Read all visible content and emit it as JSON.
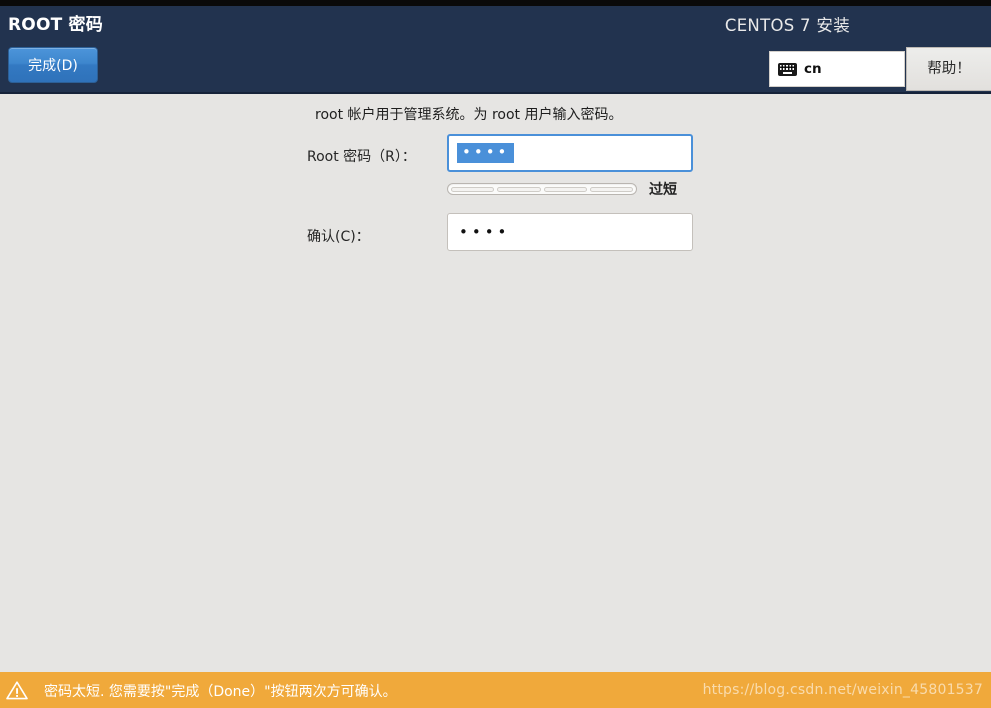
{
  "header": {
    "title": "ROOT 密码",
    "done_button": "完成(D)",
    "product_title": "CENTOS 7 安装",
    "keyboard_layout": "cn",
    "keyboard_icon": "keyboard-icon",
    "help_button": "帮助！"
  },
  "main": {
    "intro_text": "root 帐户用于管理系统。为 root 用户输入密码。",
    "password_field": {
      "label": "Root 密码（R）：",
      "value": "••••",
      "focused": true,
      "selected": true
    },
    "strength": {
      "segments_total": 4,
      "segments_filled": 0,
      "label": "过短"
    },
    "confirm_field": {
      "label": "确认(C)：",
      "value": "••••",
      "focused": false,
      "selected": false
    }
  },
  "warning_bar": {
    "icon": "warning-triangle-icon",
    "text": "密码太短. 您需要按\"完成（Done）\"按钮两次方可确认。",
    "watermark": "https://blog.csdn.net/weixin_45801537",
    "background_color": "#f0a93b"
  },
  "colors": {
    "header_bg": "#22334f",
    "body_bg": "#e6e5e3",
    "accent_blue": "#4a90d9",
    "warning_orange": "#f0a93b",
    "done_button_blue": "#3379c2"
  }
}
